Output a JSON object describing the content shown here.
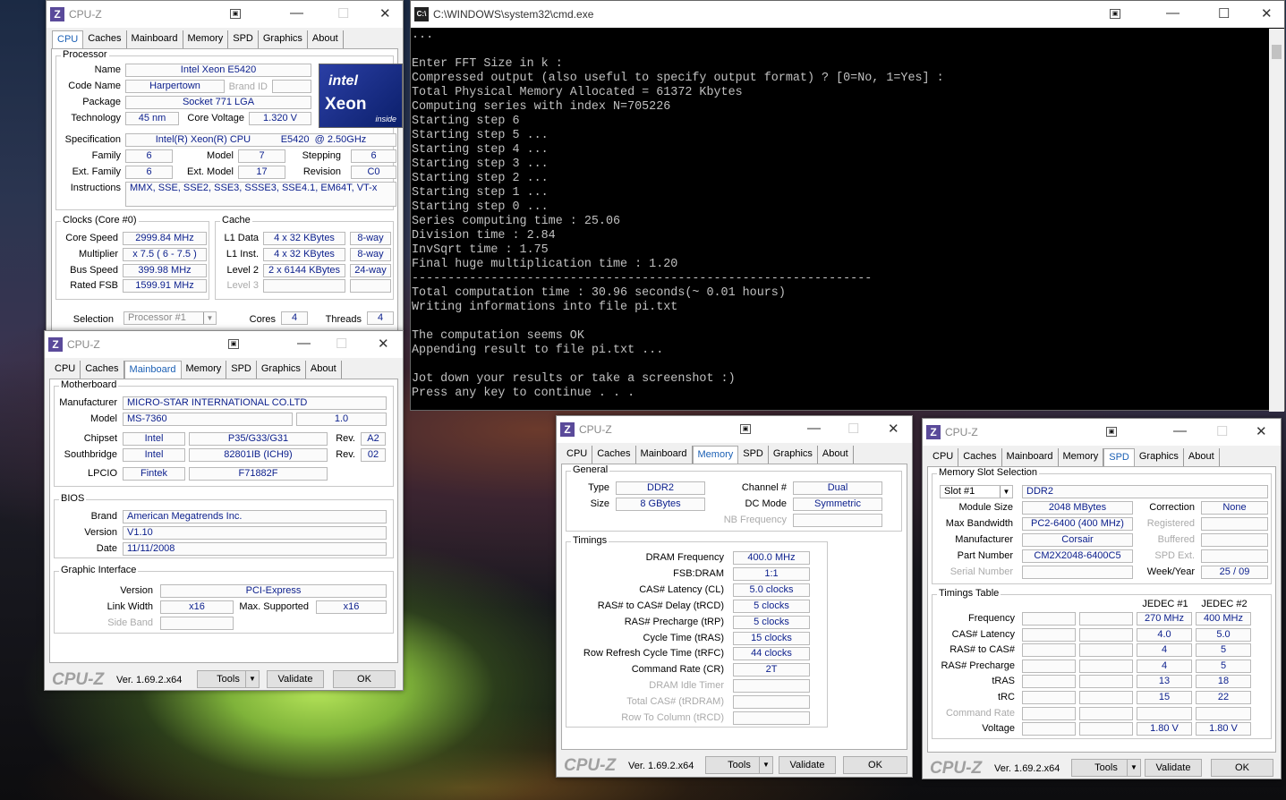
{
  "cmd": {
    "title": "C:\\WINDOWS\\system32\\cmd.exe",
    "lines": [
      "...",
      "",
      "Enter FFT Size in k :",
      "Compressed output (also useful to specify output format) ? [0=No, 1=Yes] :",
      "Total Physical Memory Allocated = 61372 Kbytes",
      "Computing series with index N=705226",
      "Starting step 6",
      "Starting step 5 ...",
      "Starting step 4 ...",
      "Starting step 3 ...",
      "Starting step 2 ...",
      "Starting step 1 ...",
      "Starting step 0 ...",
      "Series computing time : 25.06",
      "Division time : 2.84",
      "InvSqrt time : 1.75",
      "Final huge multiplication time : 1.20",
      "----------------------------------------------------------------",
      "Total computation time : 30.96 seconds(~ 0.01 hours)",
      "Writing informations into file pi.txt",
      "",
      "The computation seems OK",
      "Appending result to file pi.txt ...",
      "",
      "Jot down your results or take a screenshot :)",
      "Press any key to continue . . ."
    ]
  },
  "common": {
    "app_title": "CPU-Z",
    "logo_text": "CPU-Z",
    "version": "Ver. 1.69.2.x64",
    "tools": "Tools",
    "validate": "Validate",
    "ok": "OK",
    "tabs": [
      "CPU",
      "Caches",
      "Mainboard",
      "Memory",
      "SPD",
      "Graphics",
      "About"
    ]
  },
  "cpu": {
    "processor": "Processor",
    "name_l": "Name",
    "name": "Intel Xeon E5420",
    "codename_l": "Code Name",
    "codename": "Harpertown",
    "brandid_l": "Brand ID",
    "package_l": "Package",
    "package": "Socket 771 LGA",
    "tech_l": "Technology",
    "tech": "45 nm",
    "corev_l": "Core Voltage",
    "corev": "1.320 V",
    "spec_l": "Specification",
    "spec": "Intel(R) Xeon(R) CPU           E5420  @ 2.50GHz",
    "family_l": "Family",
    "family": "6",
    "model_l": "Model",
    "model": "7",
    "stepping_l": "Stepping",
    "stepping": "6",
    "extfam_l": "Ext. Family",
    "extfam": "6",
    "extmod_l": "Ext. Model",
    "extmod": "17",
    "rev_l": "Revision",
    "rev": "C0",
    "instr_l": "Instructions",
    "instr": "MMX, SSE, SSE2, SSE3, SSSE3, SSE4.1, EM64T, VT-x",
    "clocks": "Clocks (Core #0)",
    "cspeed_l": "Core Speed",
    "cspeed": "2999.84 MHz",
    "mult_l": "Multiplier",
    "mult": "x 7.5 ( 6 - 7.5 )",
    "bus_l": "Bus Speed",
    "bus": "399.98 MHz",
    "fsb_l": "Rated FSB",
    "fsb": "1599.91 MHz",
    "cache": "Cache",
    "l1d_l": "L1 Data",
    "l1d": "4 x 32 KBytes",
    "l1d_w": "8-way",
    "l1i_l": "L1 Inst.",
    "l1i": "4 x 32 KBytes",
    "l1i_w": "8-way",
    "l2_l": "Level 2",
    "l2": "2 x 6144 KBytes",
    "l2_w": "24-way",
    "l3_l": "Level 3",
    "sel_l": "Selection",
    "sel": "Processor #1",
    "cores_l": "Cores",
    "cores": "4",
    "threads_l": "Threads",
    "threads": "4",
    "intel1": "intel",
    "intel2": "Xeon",
    "intel3": "inside"
  },
  "mb": {
    "motherboard": "Motherboard",
    "manu_l": "Manufacturer",
    "manu": "MICRO-STAR INTERNATIONAL CO.LTD",
    "model_l": "Model",
    "model": "MS-7360",
    "model_rev": "1.0",
    "chipset_l": "Chipset",
    "chipset": "Intel",
    "chipset2": "P35/G33/G31",
    "rev_l": "Rev.",
    "chipset_rev": "A2",
    "south_l": "Southbridge",
    "south": "Intel",
    "south2": "82801IB (ICH9)",
    "south_rev": "02",
    "lpcio_l": "LPCIO",
    "lpcio": "Fintek",
    "lpcio2": "F71882F",
    "bios": "BIOS",
    "brand_l": "Brand",
    "brand": "American Megatrends Inc.",
    "ver_l": "Version",
    "ver": "V1.10",
    "date_l": "Date",
    "date": "11/11/2008",
    "gi": "Graphic Interface",
    "giver_l": "Version",
    "giver": "PCI-Express",
    "lw_l": "Link Width",
    "lw": "x16",
    "ms_l": "Max. Supported",
    "ms": "x16",
    "sb_l": "Side Band"
  },
  "mem": {
    "general": "General",
    "type_l": "Type",
    "type": "DDR2",
    "size_l": "Size",
    "size": "8 GBytes",
    "chan_l": "Channel #",
    "chan": "Dual",
    "dc_l": "DC Mode",
    "dc": "Symmetric",
    "nb_l": "NB Frequency",
    "timings": "Timings",
    "rows": [
      {
        "l": "DRAM Frequency",
        "v": "400.0 MHz",
        "g": false
      },
      {
        "l": "FSB:DRAM",
        "v": "1:1",
        "g": false
      },
      {
        "l": "CAS# Latency (CL)",
        "v": "5.0 clocks",
        "g": false
      },
      {
        "l": "RAS# to CAS# Delay (tRCD)",
        "v": "5 clocks",
        "g": false
      },
      {
        "l": "RAS# Precharge (tRP)",
        "v": "5 clocks",
        "g": false
      },
      {
        "l": "Cycle Time (tRAS)",
        "v": "15 clocks",
        "g": false
      },
      {
        "l": "Row Refresh Cycle Time (tRFC)",
        "v": "44 clocks",
        "g": false
      },
      {
        "l": "Command Rate (CR)",
        "v": "2T",
        "g": false
      },
      {
        "l": "DRAM Idle Timer",
        "v": "",
        "g": true
      },
      {
        "l": "Total CAS# (tRDRAM)",
        "v": "",
        "g": true
      },
      {
        "l": "Row To Column (tRCD)",
        "v": "",
        "g": true
      }
    ]
  },
  "spd": {
    "slotsel": "Memory Slot Selection",
    "slot": "Slot #1",
    "type": "DDR2",
    "modsize_l": "Module Size",
    "modsize": "2048 MBytes",
    "maxbw_l": "Max Bandwidth",
    "maxbw": "PC2-6400 (400 MHz)",
    "manu_l": "Manufacturer",
    "manu": "Corsair",
    "pn_l": "Part Number",
    "pn": "CM2X2048-6400C5",
    "sn_l": "Serial Number",
    "corr_l": "Correction",
    "corr": "None",
    "reg_l": "Registered",
    "buf_l": "Buffered",
    "spdext_l": "SPD Ext.",
    "wy_l": "Week/Year",
    "wy": "25 / 09",
    "tt": "Timings Table",
    "j1": "JEDEC #1",
    "j2": "JEDEC #2",
    "trows": [
      {
        "l": "Frequency",
        "a": "270 MHz",
        "b": "400 MHz",
        "g": false
      },
      {
        "l": "CAS# Latency",
        "a": "4.0",
        "b": "5.0",
        "g": false
      },
      {
        "l": "RAS# to CAS#",
        "a": "4",
        "b": "5",
        "g": false
      },
      {
        "l": "RAS# Precharge",
        "a": "4",
        "b": "5",
        "g": false
      },
      {
        "l": "tRAS",
        "a": "13",
        "b": "18",
        "g": false
      },
      {
        "l": "tRC",
        "a": "15",
        "b": "22",
        "g": false
      },
      {
        "l": "Command Rate",
        "a": "",
        "b": "",
        "g": true
      },
      {
        "l": "Voltage",
        "a": "1.80 V",
        "b": "1.80 V",
        "g": false
      }
    ]
  }
}
